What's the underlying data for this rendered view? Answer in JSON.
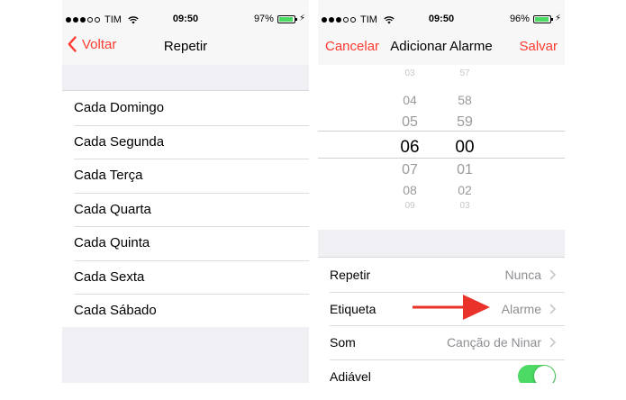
{
  "left_screen": {
    "status": {
      "carrier": "TIM",
      "time": "09:50",
      "battery_pct": "97%",
      "battery_level": 0.97
    },
    "nav": {
      "back_label": "Voltar",
      "title": "Repetir"
    },
    "days": [
      "Cada Domingo",
      "Cada Segunda",
      "Cada Terça",
      "Cada Quarta",
      "Cada Quinta",
      "Cada Sexta",
      "Cada Sábado"
    ]
  },
  "right_screen": {
    "status": {
      "carrier": "TIM",
      "time": "09:50",
      "battery_pct": "96%",
      "battery_level": 0.96
    },
    "nav": {
      "cancel_label": "Cancelar",
      "title": "Adicionar Alarme",
      "save_label": "Salvar"
    },
    "picker": {
      "hours": [
        "03",
        "04",
        "05",
        "06",
        "07",
        "08",
        "09"
      ],
      "minutes": [
        "57",
        "58",
        "59",
        "00",
        "01",
        "02",
        "03"
      ],
      "selected_hour": "06",
      "selected_minute": "00"
    },
    "settings": {
      "repeat_label": "Repetir",
      "repeat_value": "Nunca",
      "label_label": "Etiqueta",
      "label_value": "Alarme",
      "sound_label": "Som",
      "sound_value": "Canção de Ninar",
      "snooze_label": "Adiável",
      "snooze_on": true
    }
  },
  "colors": {
    "accent": "#ff3b30",
    "toggle_on": "#4cd964",
    "battery": "#4cd964",
    "section_bg": "#efeff4",
    "annotation_arrow": "#e8322a"
  },
  "icons": [
    "back-chevron-icon",
    "wifi-icon",
    "battery-icon",
    "charging-bolt-icon",
    "chevron-right-icon",
    "red-arrow-annotation"
  ]
}
